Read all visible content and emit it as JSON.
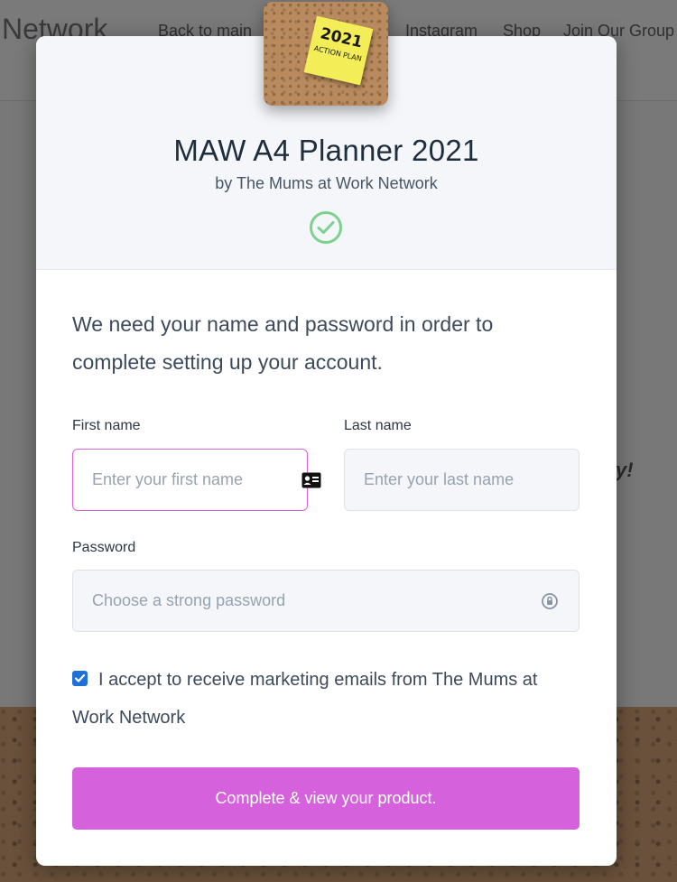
{
  "background": {
    "brand": "Network",
    "nav_links": [
      "Back to main",
      "Instagram",
      "Shop",
      "Join Our Group"
    ],
    "italic_fragment": "y!"
  },
  "product": {
    "title": "MAW A4 Planner 2021",
    "author": "by The Mums at Work Network",
    "image_text_year": "2021",
    "image_text_sub": "ACTION PLAN"
  },
  "form": {
    "intro": "We need your name and password in order to complete setting up your account.",
    "first_name_label": "First name",
    "first_name_placeholder": "Enter your first name",
    "last_name_label": "Last name",
    "last_name_placeholder": "Enter your last name",
    "password_label": "Password",
    "password_placeholder": "Choose a strong password",
    "consent_checked": true,
    "consent_text": "I accept to receive marketing emails from The Mums at Work Network",
    "submit_label": "Complete & view your product."
  },
  "colors": {
    "accent": "#d561dc",
    "success": "#7ed18d",
    "checkbox": "#1e6fd9"
  },
  "icons": {
    "first_name_field": "contact-card-icon",
    "password_field": "password-manager-icon",
    "status": "check-circle-icon"
  }
}
